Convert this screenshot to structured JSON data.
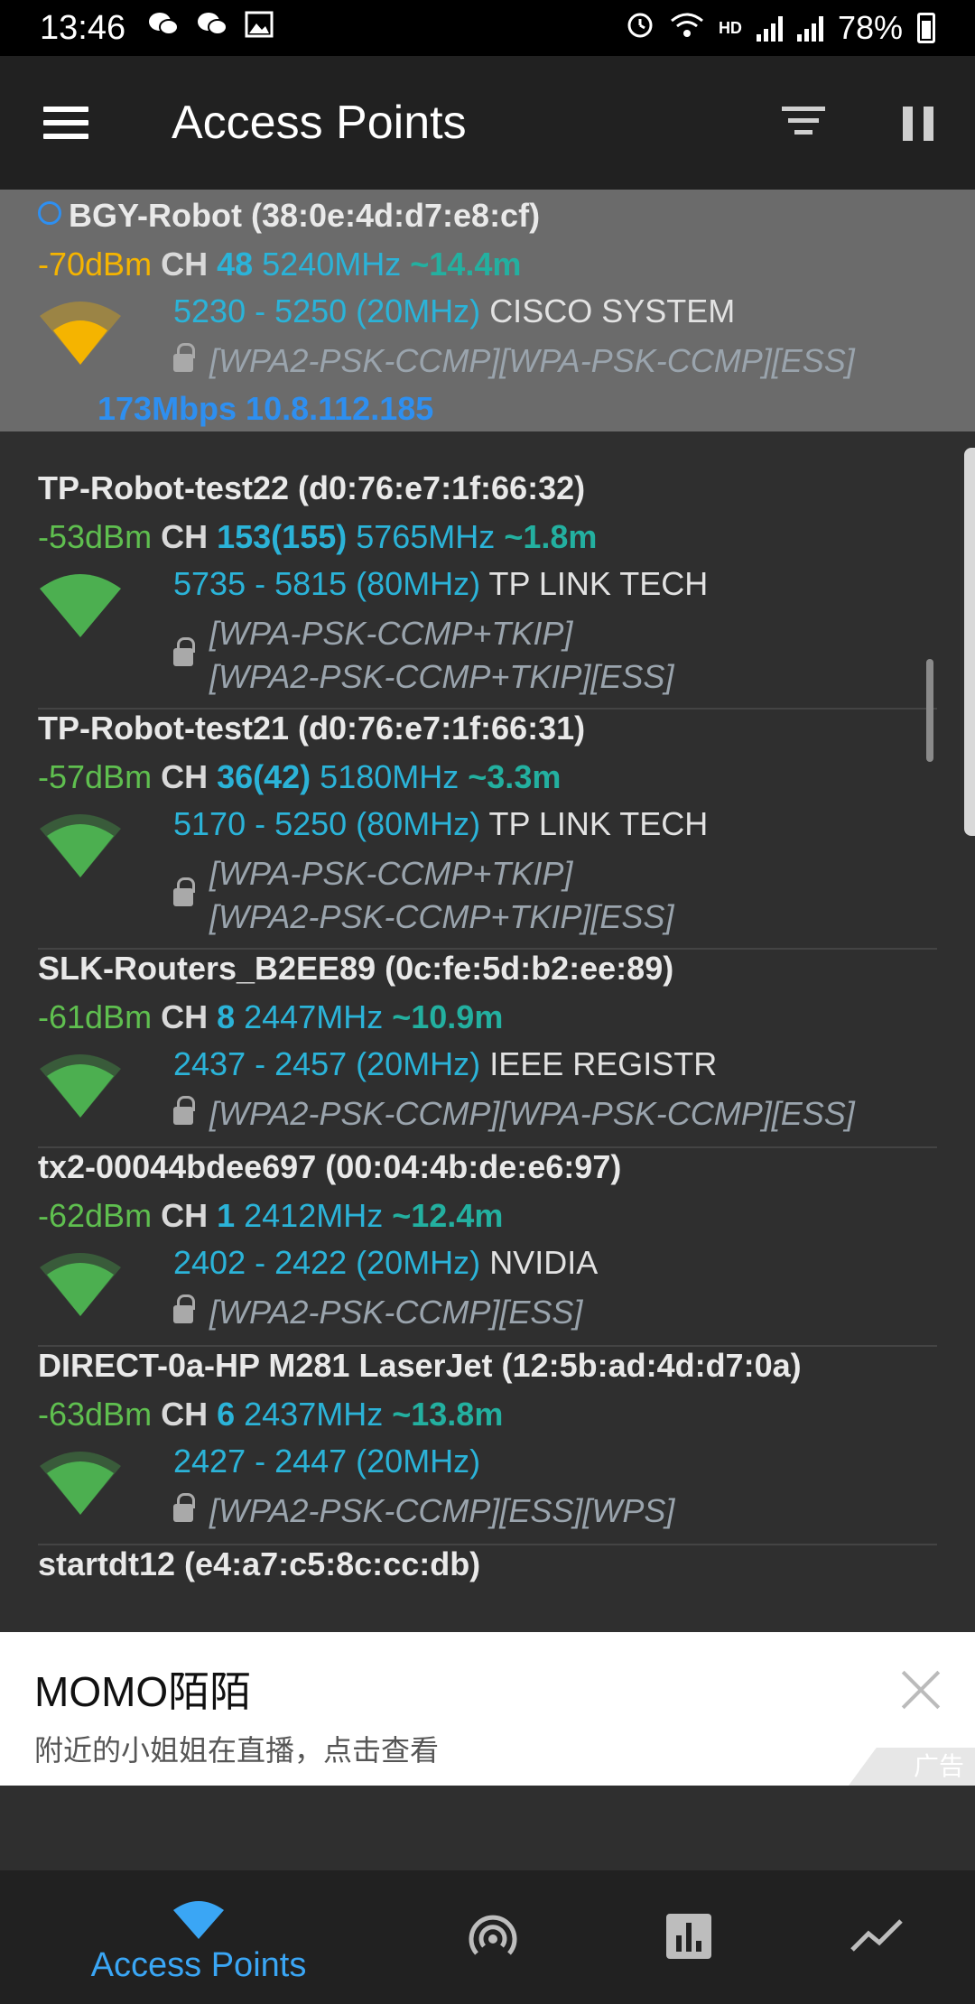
{
  "status_bar": {
    "time": "13:46",
    "network": "HD",
    "battery": "78%",
    "icons": [
      "wechat-icon",
      "wechat-icon",
      "gallery-icon",
      "alarm-icon",
      "wifi-icon",
      "signal-icon",
      "signal-icon",
      "battery-icon"
    ]
  },
  "app_bar": {
    "title": "Access Points",
    "icons": [
      "menu-icon",
      "filter-icon",
      "pause-icon"
    ]
  },
  "access_points": [
    {
      "name": "BGY-Robot (38:0e:4d:d7:e8:cf)",
      "dbm": "-70dBm",
      "ch_label": "CH",
      "ch": "48",
      "freq": "5240MHz",
      "dist": "~14.4m",
      "range": "5230 - 5250 (20MHz)",
      "vendor": "CISCO SYSTEM",
      "security": [
        "[WPA2-PSK-CCMP][WPA-PSK-CCMP][ESS]"
      ],
      "rate": "173Mbps 10.8.112.185",
      "connected": true,
      "signal_color": "#f5b400"
    },
    {
      "name": "TP-Robot-test22 (d0:76:e7:1f:66:32)",
      "dbm": "-53dBm",
      "ch_label": "CH",
      "ch": "153(155)",
      "freq": "5765MHz",
      "dist": "~1.8m",
      "range": "5735 - 5815 (80MHz)",
      "vendor": "TP LINK TECH",
      "security": [
        "[WPA-PSK-CCMP+TKIP]",
        "[WPA2-PSK-CCMP+TKIP][ESS]"
      ],
      "signal_color": "#4caf50"
    },
    {
      "name": "TP-Robot-test21 (d0:76:e7:1f:66:31)",
      "dbm": "-57dBm",
      "ch_label": "CH",
      "ch": "36(42)",
      "freq": "5180MHz",
      "dist": "~3.3m",
      "range": "5170 - 5250 (80MHz)",
      "vendor": "TP LINK TECH",
      "security": [
        "[WPA-PSK-CCMP+TKIP]",
        "[WPA2-PSK-CCMP+TKIP][ESS]"
      ],
      "signal_color": "#4caf50"
    },
    {
      "name": "SLK-Routers_B2EE89 (0c:fe:5d:b2:ee:89)",
      "dbm": "-61dBm",
      "ch_label": "CH",
      "ch": "8",
      "freq": "2447MHz",
      "dist": "~10.9m",
      "range": "2437 - 2457 (20MHz)",
      "vendor": "IEEE REGISTR",
      "security": [
        "[WPA2-PSK-CCMP][WPA-PSK-CCMP][ESS]"
      ],
      "signal_color": "#4caf50"
    },
    {
      "name": "tx2-00044bdee697 (00:04:4b:de:e6:97)",
      "dbm": "-62dBm",
      "ch_label": "CH",
      "ch": "1",
      "freq": "2412MHz",
      "dist": "~12.4m",
      "range": "2402 - 2422 (20MHz)",
      "vendor": "NVIDIA",
      "security": [
        "[WPA2-PSK-CCMP][ESS]"
      ],
      "signal_color": "#4caf50"
    },
    {
      "name": "DIRECT-0a-HP M281 LaserJet (12:5b:ad:4d:d7:0a)",
      "dbm": "-63dBm",
      "ch_label": "CH",
      "ch": "6",
      "freq": "2437MHz",
      "dist": "~13.8m",
      "range": "2427 - 2447 (20MHz)",
      "vendor": "",
      "security": [
        "[WPA2-PSK-CCMP][ESS][WPS]"
      ],
      "signal_color": "#4caf50"
    },
    {
      "name": "startdt12 (e4:a7:c5:8c:cc:db)"
    }
  ],
  "ad": {
    "title": "MOMO陌陌",
    "description": "附近的小姐姐在直播，点击查看",
    "tag": "广告"
  },
  "bottom_nav": {
    "active_label": "Access Points",
    "active_color": "#3aa6f5",
    "items": [
      "wifi-icon",
      "radar-icon",
      "bar-chart-icon",
      "trend-icon"
    ]
  }
}
